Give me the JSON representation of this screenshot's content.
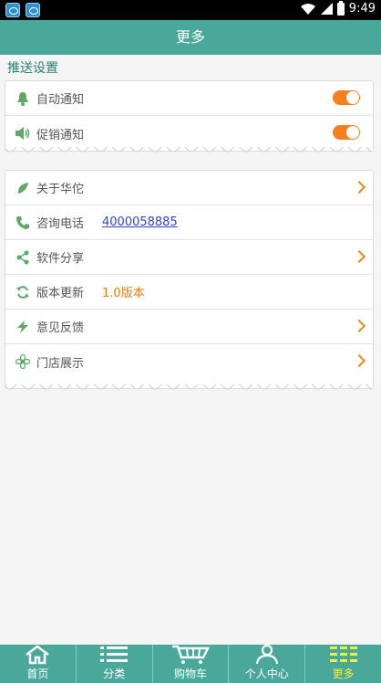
{
  "status_bar": {
    "time": "9:49"
  },
  "header": {
    "title": "更多"
  },
  "push_settings": {
    "section_title": "推送设置",
    "items": [
      {
        "label": "自动通知",
        "icon": "bell-icon",
        "enabled": true
      },
      {
        "label": "促销通知",
        "icon": "speaker-icon",
        "enabled": true
      }
    ]
  },
  "menu": {
    "items": [
      {
        "label": "关于华佗",
        "icon": "leaf-icon",
        "value": ""
      },
      {
        "label": "咨询电话",
        "icon": "phone-icon",
        "value": "4000058885"
      },
      {
        "label": "软件分享",
        "icon": "share-icon",
        "value": ""
      },
      {
        "label": "版本更新",
        "icon": "refresh-icon",
        "value": "1.0版本"
      },
      {
        "label": "意见反馈",
        "icon": "lightning-icon",
        "value": ""
      },
      {
        "label": "门店展示",
        "icon": "flower-icon",
        "value": ""
      }
    ]
  },
  "tab_bar": {
    "tabs": [
      {
        "label": "首页",
        "icon": "home-icon"
      },
      {
        "label": "分类",
        "icon": "list-icon"
      },
      {
        "label": "购物车",
        "icon": "cart-icon"
      },
      {
        "label": "个人中心",
        "icon": "person-icon"
      },
      {
        "label": "更多",
        "icon": "more-icon",
        "active": true
      }
    ]
  },
  "colors": {
    "primary": "#4aa89b",
    "toggle": "#f47f20",
    "chevron": "#e58a14",
    "active_tab": "#f0f040"
  }
}
